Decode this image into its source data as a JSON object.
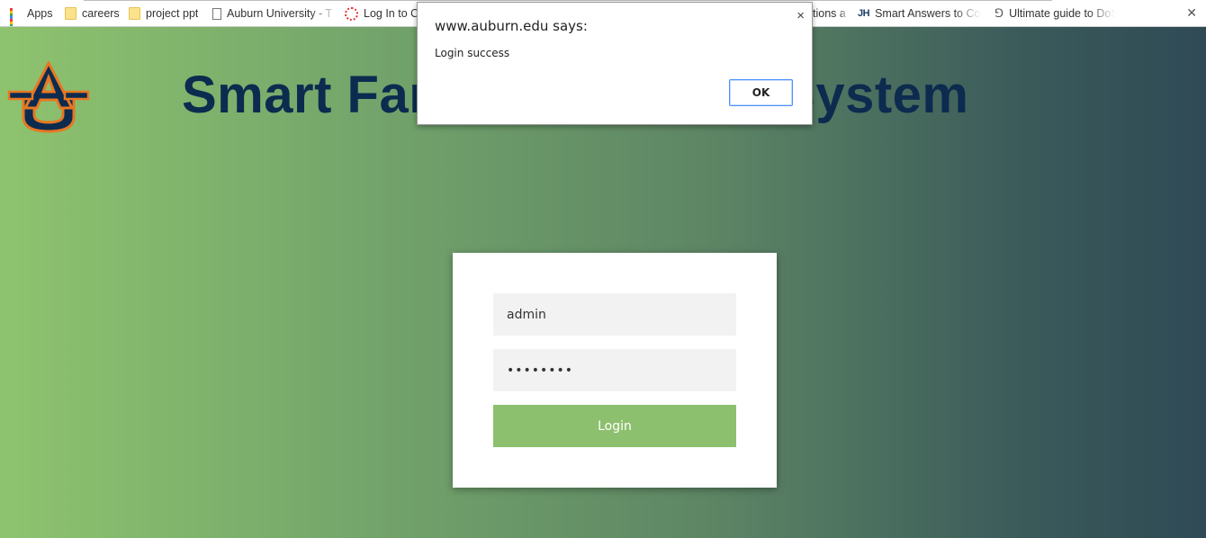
{
  "bookmarks": [
    {
      "label": "Apps",
      "icon": "apps-grid-icon"
    },
    {
      "label": "careers",
      "icon": "folder-icon"
    },
    {
      "label": "project ppt",
      "icon": "folder-icon"
    },
    {
      "label": "Auburn University - T",
      "icon": "document-icon"
    },
    {
      "label": "Log In to C",
      "icon": "canvas-ring-icon"
    },
    {
      "label": "tions a",
      "icon": ""
    },
    {
      "label": "Smart Answers to Con",
      "icon": "jh-logo-icon"
    },
    {
      "label": "Ultimate guide to DoS",
      "icon": "g-logo-icon"
    }
  ],
  "header": {
    "title": "Smart Farm Monitoring System",
    "logo_text": "AU"
  },
  "login": {
    "username_value": "admin",
    "password_value": "••••••••",
    "button_label": "Login"
  },
  "dialog": {
    "title": "www.auburn.edu says:",
    "message": "Login success",
    "ok_label": "OK",
    "close_glyph": "×"
  },
  "colors": {
    "accent_green": "#8dc06e",
    "title_navy": "#0c2b4f",
    "logo_orange": "#e87722"
  }
}
